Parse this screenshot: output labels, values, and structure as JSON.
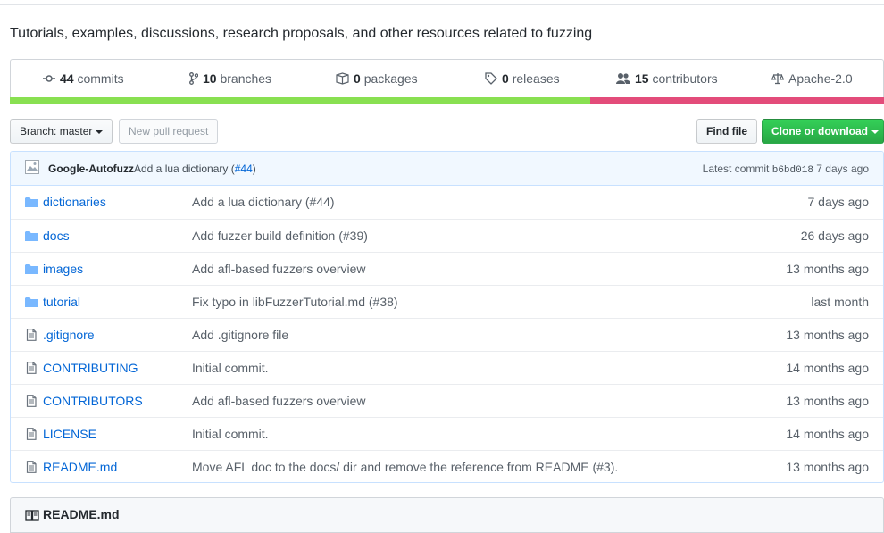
{
  "repo": {
    "description": "Tutorials, examples, discussions, research proposals, and other resources related to fuzzing"
  },
  "summary": {
    "commits": {
      "count": "44",
      "label": "commits"
    },
    "branches": {
      "count": "10",
      "label": "branches"
    },
    "packages": {
      "count": "0",
      "label": "packages"
    },
    "releases": {
      "count": "0",
      "label": "releases"
    },
    "contributors": {
      "count": "15",
      "label": "contributors"
    },
    "license": "Apache-2.0"
  },
  "languages": [
    {
      "color": "#89e051",
      "percent": 66.3
    },
    {
      "color": "#e34c7a",
      "percent": 33.7
    }
  ],
  "toolbar": {
    "branch_label": "Branch:",
    "branch_value": "master",
    "new_pr_label": "New pull request",
    "find_file_label": "Find file",
    "clone_label": "Clone or download"
  },
  "latest_commit": {
    "author": "Google-Autofuzz",
    "message": "Add a lua dictionary (",
    "pr_link": "#44",
    "message_end": ")",
    "latest_label": "Latest commit",
    "sha": "b6bd018",
    "age": "7 days ago"
  },
  "files": [
    {
      "type": "dir",
      "name": "dictionaries",
      "message": "Add a lua dictionary (#44)",
      "age": "7 days ago"
    },
    {
      "type": "dir",
      "name": "docs",
      "message": "Add fuzzer build definition (#39)",
      "age": "26 days ago"
    },
    {
      "type": "dir",
      "name": "images",
      "message": "Add afl-based fuzzers overview",
      "age": "13 months ago"
    },
    {
      "type": "dir",
      "name": "tutorial",
      "message": "Fix typo in libFuzzerTutorial.md (#38)",
      "age": "last month"
    },
    {
      "type": "file",
      "name": ".gitignore",
      "message": "Add .gitignore file",
      "age": "13 months ago"
    },
    {
      "type": "file",
      "name": "CONTRIBUTING",
      "message": "Initial commit.",
      "age": "14 months ago"
    },
    {
      "type": "file",
      "name": "CONTRIBUTORS",
      "message": "Add afl-based fuzzers overview",
      "age": "13 months ago"
    },
    {
      "type": "file",
      "name": "LICENSE",
      "message": "Initial commit.",
      "age": "14 months ago"
    },
    {
      "type": "file",
      "name": "README.md",
      "message": "Move AFL doc to the docs/ dir and remove the reference from README (#3).",
      "age": "13 months ago"
    }
  ],
  "readme": {
    "title": "README.md"
  }
}
